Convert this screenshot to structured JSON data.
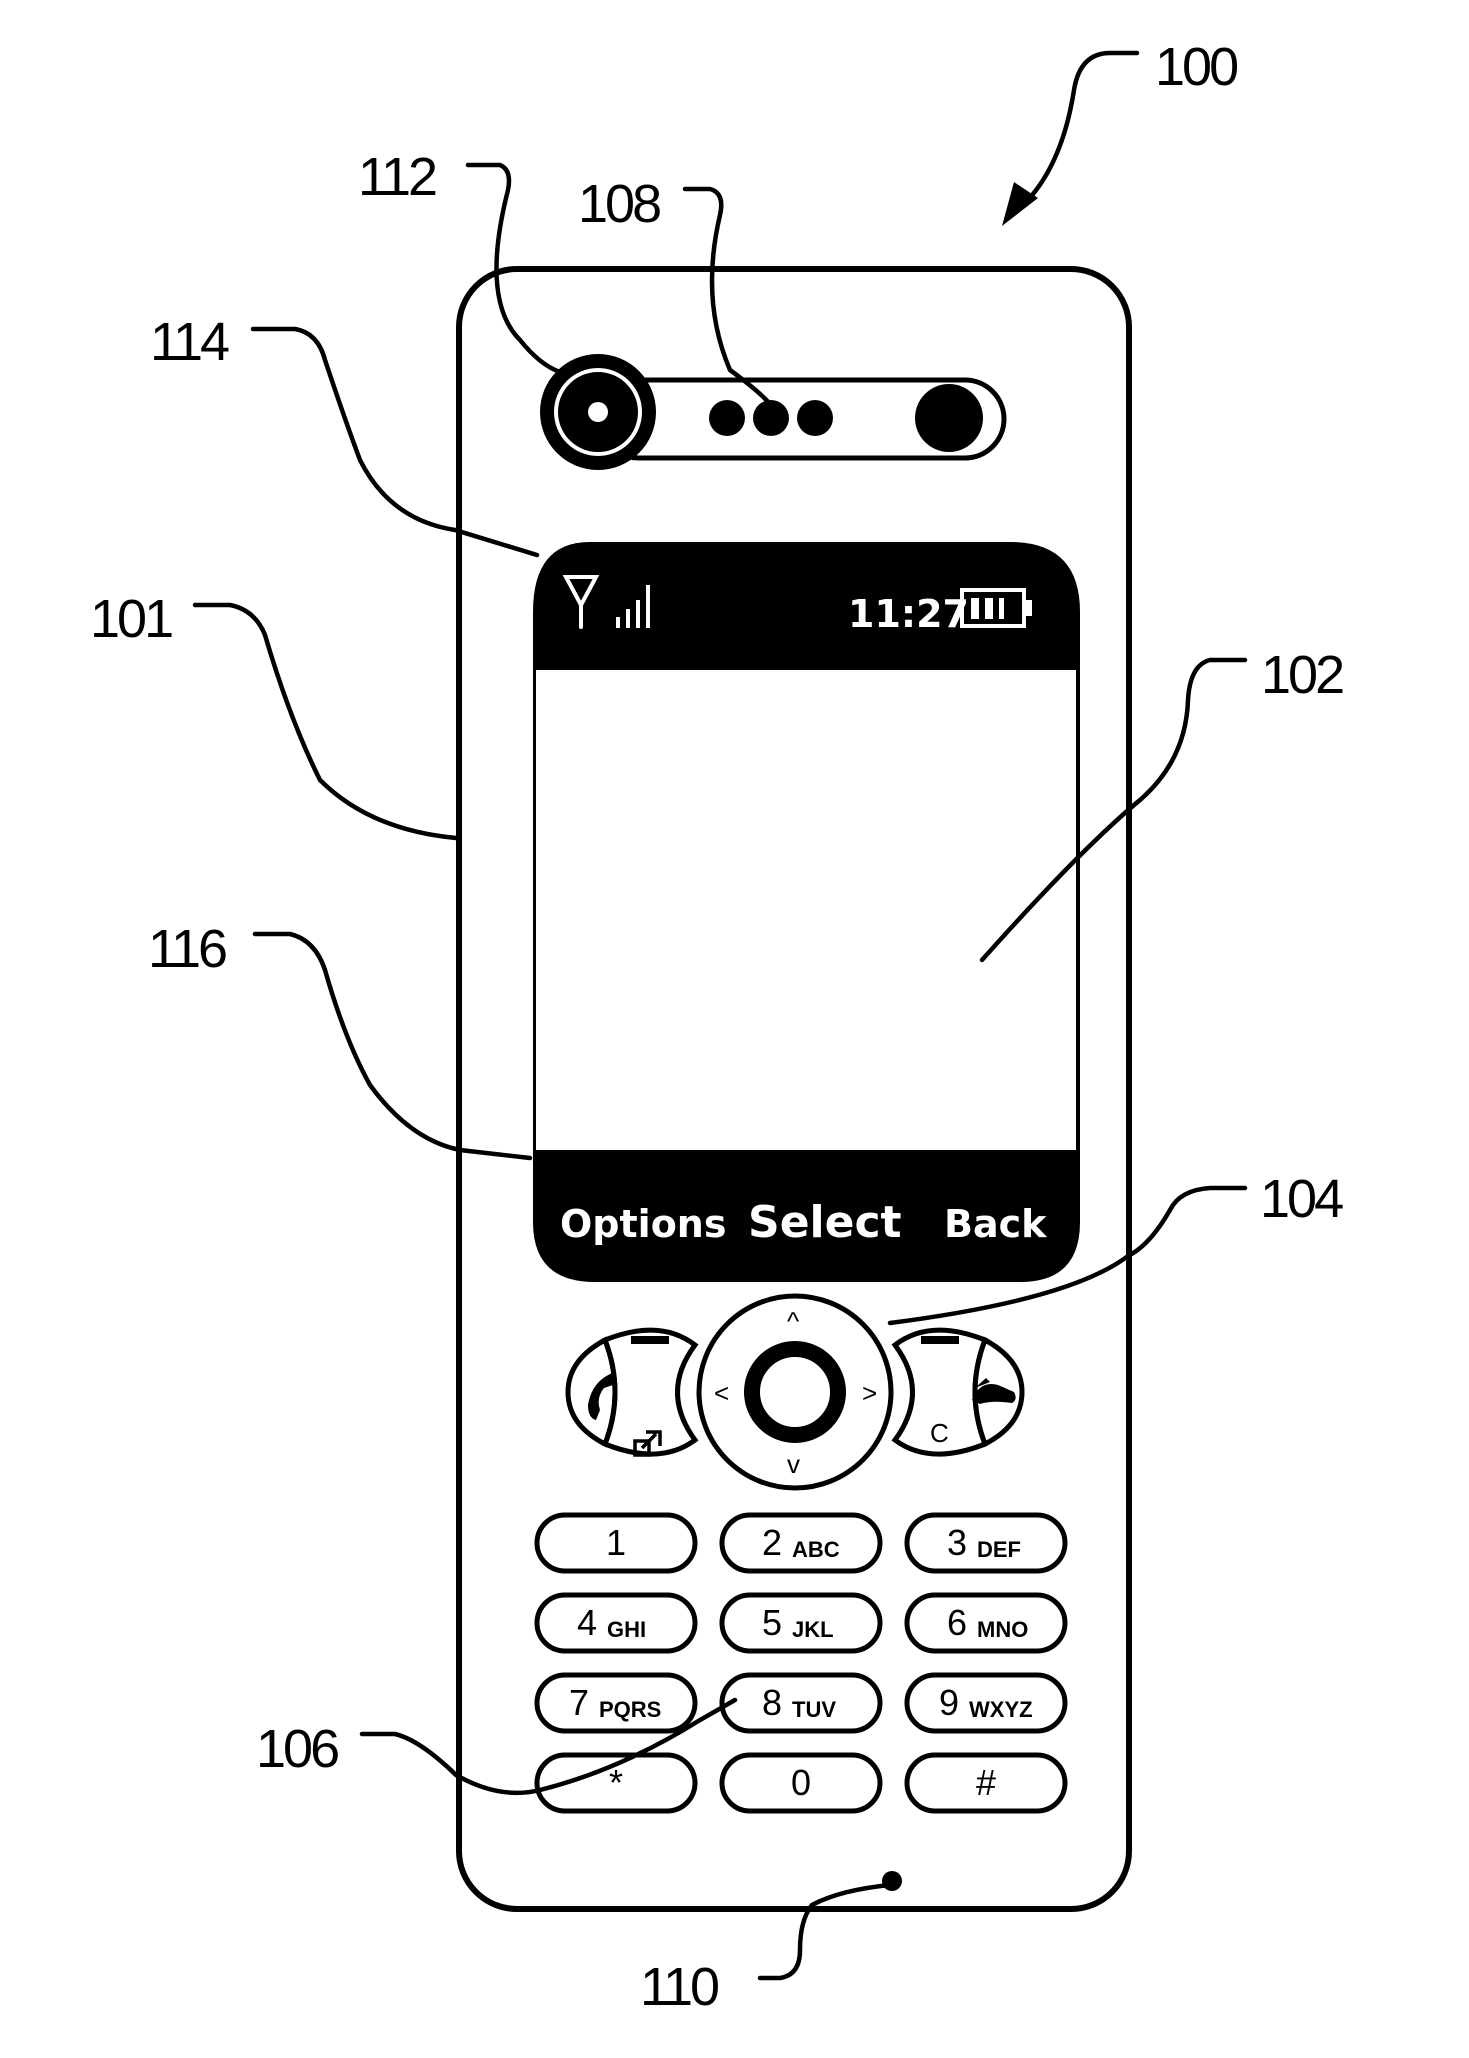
{
  "figure": {
    "reference_labels": {
      "device": "100",
      "housing": "101",
      "display": "102",
      "navigation_keys": "104",
      "keypad": "106",
      "earpiece": "108",
      "microphone": "110",
      "camera": "112",
      "status_bar": "114",
      "softkey_bar": "116"
    }
  },
  "screen": {
    "status_bar": {
      "antenna_icon": "antenna-icon",
      "signal_icon": "signal-strength-icon",
      "signal_bars": 4,
      "time": "11:27",
      "battery_icon": "battery-icon",
      "battery_bars": 3
    },
    "content": "",
    "softkeys": {
      "left": "Options",
      "center": "Select",
      "right": "Back"
    }
  },
  "nav_cluster": {
    "call_key_icon": "phone-handset-icon",
    "call_key_secondary_icon": "external-link-icon",
    "end_key_icon": "end-call-icon",
    "clear_key_label": "C",
    "dpad": {
      "up": "^",
      "down": "v",
      "left": "<",
      "right": ">"
    }
  },
  "keypad": {
    "keys": [
      {
        "num": "1",
        "letters": ""
      },
      {
        "num": "2",
        "letters": "ABC"
      },
      {
        "num": "3",
        "letters": "DEF"
      },
      {
        "num": "4",
        "letters": "GHI"
      },
      {
        "num": "5",
        "letters": "JKL"
      },
      {
        "num": "6",
        "letters": "MNO"
      },
      {
        "num": "7",
        "letters": "PQRS"
      },
      {
        "num": "8",
        "letters": "TUV"
      },
      {
        "num": "9",
        "letters": "WXYZ"
      },
      {
        "num": "*",
        "letters": ""
      },
      {
        "num": "0",
        "letters": ""
      },
      {
        "num": "#",
        "letters": ""
      }
    ]
  }
}
